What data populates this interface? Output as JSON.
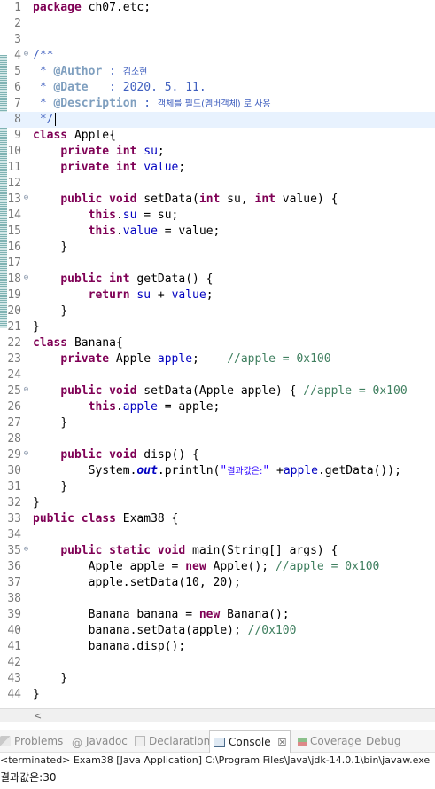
{
  "editor": {
    "line_numbers": [
      "1",
      "2",
      "3",
      "4",
      "5",
      "6",
      "7",
      "8",
      "9",
      "10",
      "11",
      "12",
      "13",
      "14",
      "15",
      "16",
      "17",
      "18",
      "19",
      "20",
      "21",
      "22",
      "23",
      "24",
      "25",
      "26",
      "27",
      "28",
      "29",
      "30",
      "31",
      "32",
      "33",
      "34",
      "35",
      "36",
      "37",
      "38",
      "39",
      "40",
      "41",
      "42",
      "43",
      "44"
    ],
    "code": {
      "l1_kw": "package",
      "l1_rest": " ch07.etc;",
      "l4": "/**",
      "l5_pre": " * ",
      "l5_tag": "@Author",
      "l5_sep": " : ",
      "l5_val": "김소현",
      "l6_pre": " * ",
      "l6_tag": "@Date",
      "l6_sep": "   : ",
      "l6_val": "2020. 5. 11.",
      "l7_pre": " * ",
      "l7_tag": "@Description",
      "l7_sep": " : ",
      "l7_val": "객체를 필드(멤버객체) 로 사용",
      "l8": " */",
      "l9_kw": "class",
      "l9_rest": " Apple{",
      "l10_kw1": "private",
      "l10_kw2": "int",
      "l10_fd": "su",
      "l11_kw1": "private",
      "l11_kw2": "int",
      "l11_fd": "value",
      "l13_kw1": "public",
      "l13_kw2": "void",
      "l13_a": " setData(",
      "l13_kw3": "int",
      "l13_b": " su, ",
      "l13_kw4": "int",
      "l13_c": " value) {",
      "l14_kw": "this",
      "l14_fd": "su",
      "l14_rest": " = su;",
      "l15_kw": "this",
      "l15_fd": "value",
      "l15_rest": " = value;",
      "l16": "}",
      "l18_kw1": "public",
      "l18_kw2": "int",
      "l18_rest": " getData() {",
      "l19_kw": "return",
      "l19_fd1": "su",
      "l19_op": " + ",
      "l19_fd2": "value",
      "l20": "}",
      "l21": "}",
      "l22_kw": "class",
      "l22_rest": " Banana{",
      "l23_kw": "private",
      "l23_type": " Apple ",
      "l23_fd": "apple",
      "l23_cm": "//apple = 0x100",
      "l25_kw1": "public",
      "l25_kw2": "void",
      "l25_a": " setData(Apple apple) { ",
      "l25_cm": "//apple = 0x100",
      "l26_kw": "this",
      "l26_fd": "apple",
      "l26_rest": " = apple;",
      "l27": "}",
      "l29_kw1": "public",
      "l29_kw2": "void",
      "l29_rest": " disp() {",
      "l30_a": "System.",
      "l30_out": "out",
      "l30_b": ".println(",
      "l30_str1": "\"",
      "l30_str_kr": "결과값은:",
      "l30_str2": "\"",
      "l30_c": " +",
      "l30_fd": "apple",
      "l30_d": ".getData());",
      "l31": "}",
      "l32": "}",
      "l33_kw1": "public",
      "l33_kw2": "class",
      "l33_rest": " Exam38 {",
      "l35_kw1": "public",
      "l35_kw2": "static",
      "l35_kw3": "void",
      "l35_rest": " main(String[] args) {",
      "l36_a": "Apple apple = ",
      "l36_kw": "new",
      "l36_b": " Apple(); ",
      "l36_cm": "//apple = 0x100",
      "l37": "apple.setData(10, 20);",
      "l39_a": "Banana banana = ",
      "l39_kw": "new",
      "l39_b": " Banana();",
      "l40_a": "banana.setData(apple); ",
      "l40_cm": "//0x100",
      "l41": "banana.disp();",
      "l43": "}",
      "l44": "}"
    }
  },
  "scrollbar": {
    "left_arrow": "<"
  },
  "bottom_tabs": {
    "problems": "Problems",
    "javadoc": "Javadoc",
    "declaration": "Declaration",
    "console": "Console",
    "console_close": "☒",
    "coverage": "Coverage",
    "debug": "Debug"
  },
  "console": {
    "status": "<terminated> Exam38 [Java Application] C:\\Program Files\\Java\\jdk-14.0.1\\bin\\javaw.exe",
    "output": "결과값은:30"
  },
  "colors": {
    "keyword": "#7f0055",
    "field": "#0000c0",
    "comment": "#3f7f5f",
    "javadoc": "#3f5fbf",
    "string": "#2a00ff",
    "line_highlight": "#e8f2fe"
  }
}
